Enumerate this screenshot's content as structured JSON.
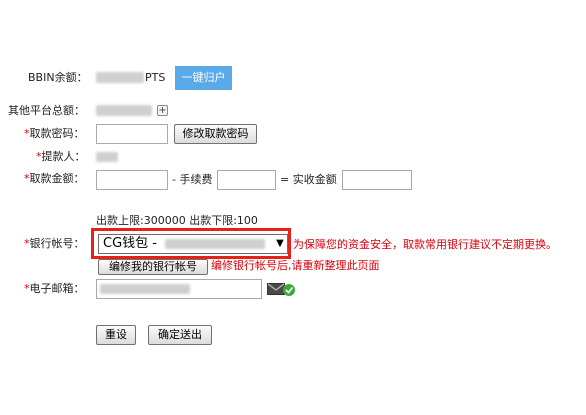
{
  "bbin": {
    "label": "BBIN余额：",
    "unit": "PTS",
    "transfer_button": "一键归户"
  },
  "other_balance": {
    "label": "其他平台总额："
  },
  "withdraw_password": {
    "required_mark": "*",
    "label": "取款密码：",
    "value": "",
    "change_button": "修改取款密码"
  },
  "payee": {
    "required_mark": "*",
    "label": "提款人："
  },
  "withdraw_amount": {
    "required_mark": "*",
    "label": "取款金额：",
    "amount_value": "",
    "fee_label": "- 手续费",
    "fee_value": "",
    "actual_label": "= 实收金额",
    "actual_value": ""
  },
  "limits": {
    "text": "出款上限:300000 出款下限:100"
  },
  "bank_account": {
    "required_mark": "*",
    "label": "银行帐号：",
    "selected_prefix": "CG钱包 -",
    "security_note": "为保障您的资金安全，取款常用银行建议不定期更换。",
    "edit_button": "编修我的银行帐号",
    "edit_note": "编修银行帐号后,请重新整理此页面"
  },
  "email": {
    "required_mark": "*",
    "label": "电子邮箱：",
    "icon_color": "#3aab3a"
  },
  "actions": {
    "reset_button": "重设",
    "submit_button": "确定送出"
  },
  "colors": {
    "accent_blue": "#5aa9e8",
    "required_red": "#d9000d",
    "highlight_red": "#e62117"
  }
}
